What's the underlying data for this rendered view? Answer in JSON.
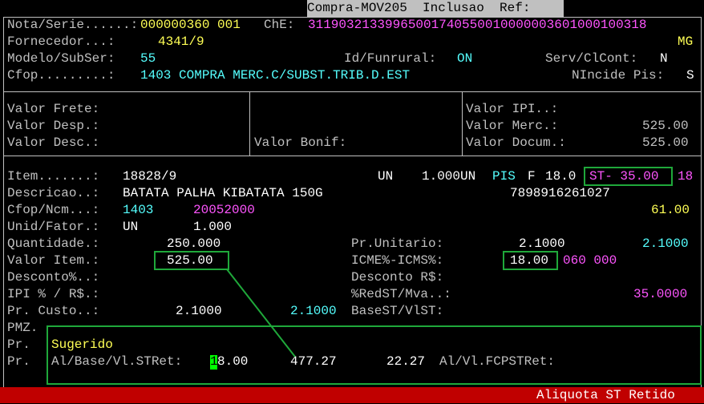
{
  "header": {
    "title": "Compra-MOV205  Inclusao  Ref:"
  },
  "doc": {
    "nota_label": "Nota/Serie......:",
    "nota_value": "000000360 001",
    "che_label": "ChE:",
    "che_value": "31190321339965001740550010000003601000100318",
    "fornecedor_label": "Fornecedor...:",
    "fornecedor_value": "4341/9",
    "uf": "MG",
    "modelo_label": "Modelo/SubSer:",
    "modelo_value": "55",
    "funrural_label": "Id/Funrural:",
    "funrural_value": "ON",
    "servclcont_label": "Serv/ClCont:",
    "servclcont_value": "N",
    "cfop_label": "Cfop.........:",
    "cfop_value": "1403 COMPRA MERC.C/SUBST.TRIB.D.EST",
    "nincide_label": "NIncide Pis:",
    "nincide_value": "S"
  },
  "totals": {
    "frete_label": "Valor Frete:",
    "desp_label": "Valor Desp.:",
    "desc_label": "Valor Desc.:",
    "bonif_label": "Valor Bonif:",
    "ipi_label": "Valor IPI..:",
    "merc_label": "Valor Merc.:",
    "merc_value": "525.00",
    "docum_label": "Valor Docum.:",
    "docum_value": "525.00"
  },
  "item": {
    "item_label": "Item.......:",
    "item_value": "18828/9",
    "un": "UN",
    "qty_un": "1.000UN",
    "pis": "PIS",
    "flag": "F",
    "aliq": "18.0",
    "st": "ST- 35.00",
    "st_extra": "18",
    "descricao_label": "Descricao..:",
    "descricao_value": "BATATA PALHA KIBATATA 150G",
    "ean": "7898916261027",
    "cfopncm_label": "Cfop/Ncm...:",
    "cfop": "1403",
    "ncm": "20052000",
    "right_val": "61.00",
    "unid_label": "Unid/Fator.:",
    "unid": "UN",
    "fator": "1.000",
    "quantidade_label": "Quantidade.:",
    "quantidade": "250.000",
    "prunit_label": "Pr.Unitario:",
    "prunit": "2.1000",
    "prunit2": "2.1000",
    "valoritem_label": "Valor Item.:",
    "valoritem": "525.00",
    "icms_label": "ICME%-ICMS%:",
    "icms": "18.00",
    "icms_extra": "060 000",
    "desconto_label": "Desconto%..:",
    "descontors_label": "Desconto R$:",
    "ipi_label": "IPI % / R$.:",
    "redst_label": "%RedST/Mva..:",
    "mva": "35.0000",
    "prcusto_label": "Pr. Custo..:",
    "prcusto": "2.1000",
    "prcusto2": "2.1000",
    "basest_label": "BaseST/VlST:",
    "pmz_label": "PMZ.",
    "pr1": "Pr.",
    "pr2": "Pr."
  },
  "sugerido": {
    "title": "Sugerido",
    "label": "Al/Base/Vl.STRet:",
    "cursor_char": "1",
    "aliq_rest": "8.00",
    "base": "477.27",
    "valor": "22.27",
    "fcp_label": "Al/Vl.FCPSTRet:"
  },
  "status": {
    "message": "Aliquota ST Retido"
  }
}
